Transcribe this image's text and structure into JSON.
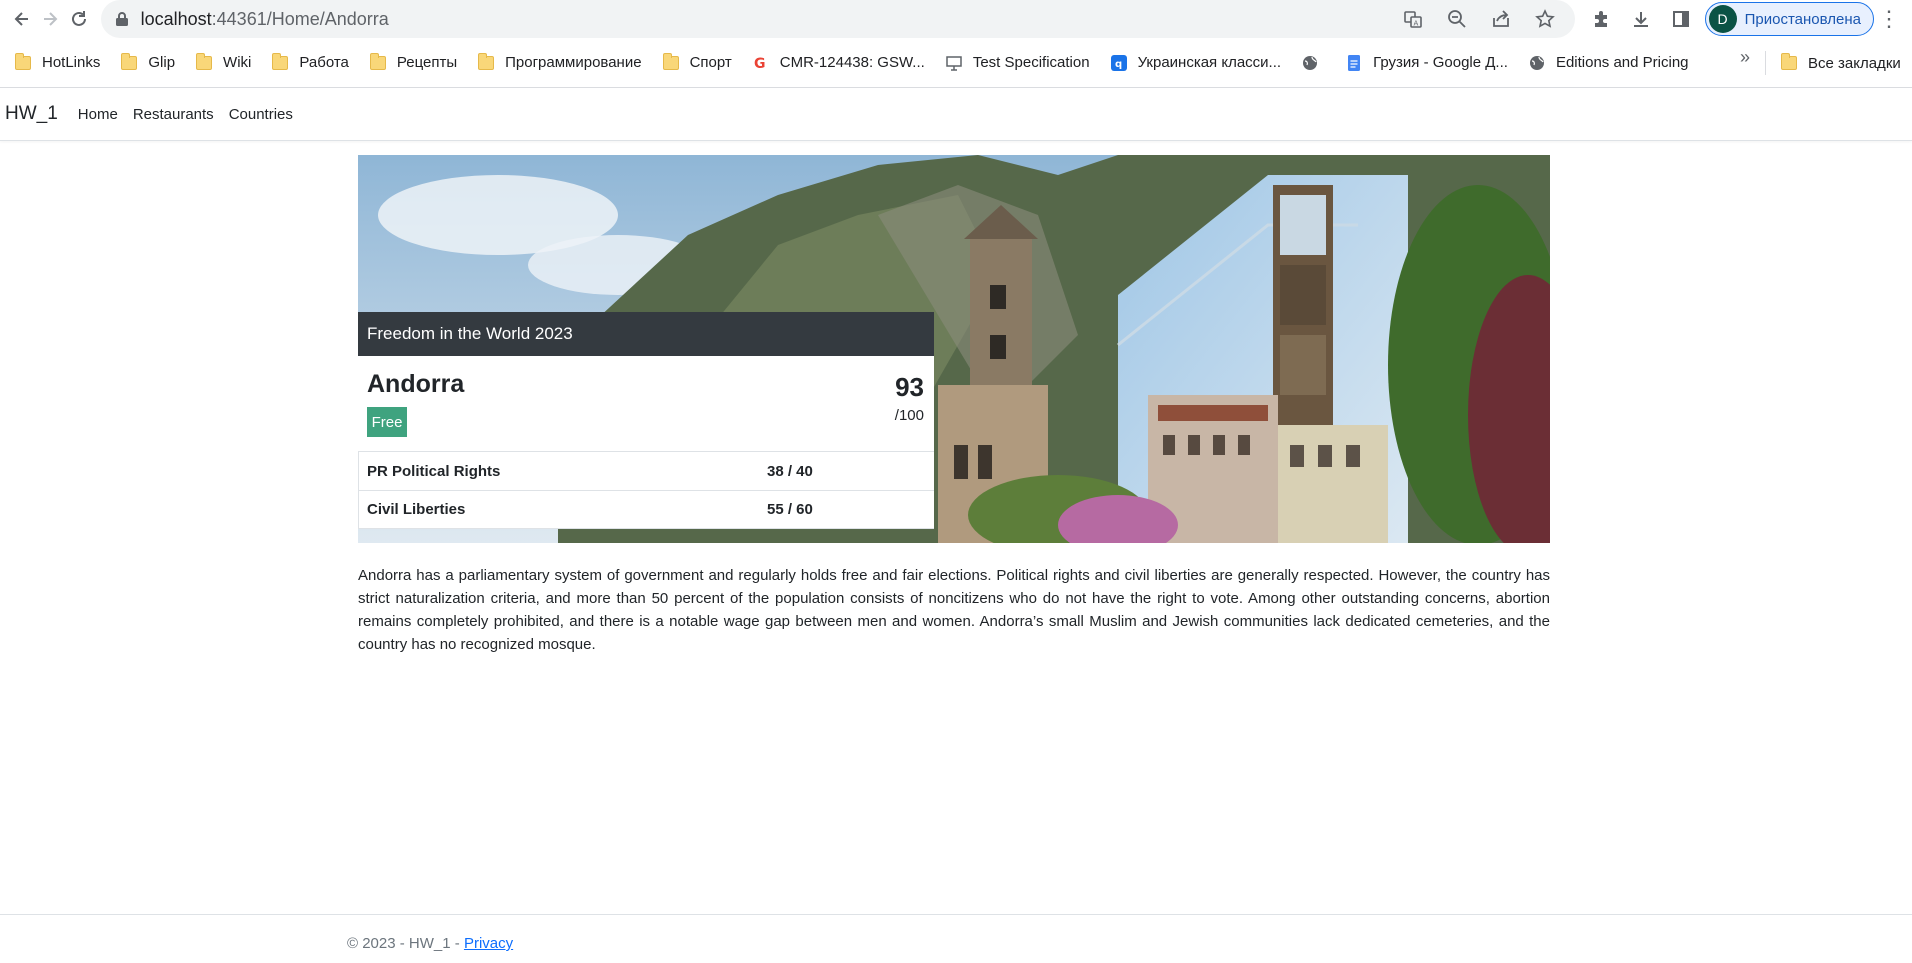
{
  "browser": {
    "url_host": "localhost",
    "url_rest": ":44361/Home/Andorra",
    "profile_initial": "D",
    "profile_label": "Приостановлена"
  },
  "bookmarks": [
    {
      "label": "HotLinks",
      "icon": "folder-icon"
    },
    {
      "label": "Glip",
      "icon": "folder-icon"
    },
    {
      "label": "Wiki",
      "icon": "folder-icon"
    },
    {
      "label": "Работа",
      "icon": "folder-icon"
    },
    {
      "label": "Рецепты",
      "icon": "folder-icon"
    },
    {
      "label": "Программирование",
      "icon": "folder-icon"
    },
    {
      "label": "Спорт",
      "icon": "folder-icon"
    },
    {
      "label": "CMR-124438: GSW...",
      "icon": "google-icon"
    },
    {
      "label": "Test Specification",
      "icon": "presentation-icon"
    },
    {
      "label": "Украинская класси...",
      "icon": "q-icon"
    },
    {
      "label": "",
      "icon": "globe-icon"
    },
    {
      "label": "Грузия - Google Д...",
      "icon": "docs-icon"
    },
    {
      "label": "Editions and Pricing",
      "icon": "globe-icon"
    }
  ],
  "bookmarks_more": "»",
  "bookmarks_all": "Все закладки",
  "app": {
    "brand": "HW_1",
    "nav": [
      "Home",
      "Restaurants",
      "Countries"
    ]
  },
  "card": {
    "header": "Freedom in the World 2023",
    "country": "Andorra",
    "status": "Free",
    "score": "93",
    "score_max": "/100",
    "rows": [
      {
        "label": "PR Political Rights",
        "value": "38 / 40"
      },
      {
        "label": "Civil Liberties",
        "value": "55 / 60"
      }
    ]
  },
  "description": "Andorra has a parliamentary system of government and regularly holds free and fair elections. Political rights and civil liberties are generally respected. However, the country has strict naturalization criteria, and more than 50 percent of the population consists of noncitizens who do not have the right to vote. Among other outstanding concerns, abortion remains completely prohibited, and there is a notable wage gap between men and women. Andorra’s small Muslim and Jewish communities lack dedicated cemeteries, and the country has no recognized mosque.",
  "footer": {
    "text": "© 2023 - HW_1 - ",
    "privacy": "Privacy"
  },
  "colors": {
    "card_header": "#343a40",
    "badge_free": "#3fa37f",
    "link": "#0d6efd"
  }
}
